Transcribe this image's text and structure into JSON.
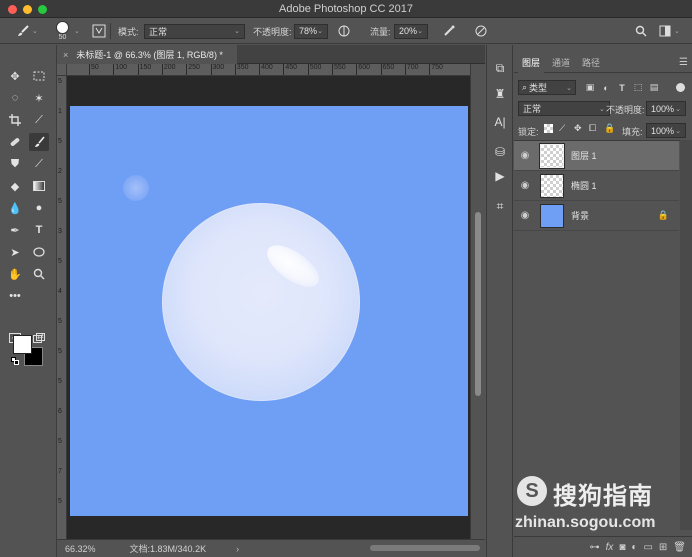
{
  "window": {
    "title": "Adobe Photoshop CC 2017"
  },
  "options_bar": {
    "brush_size": "50",
    "mode_label": "模式:",
    "mode_value": "正常",
    "opacity_label": "不透明度:",
    "opacity_value": "78%",
    "flow_label": "流量:",
    "flow_value": "20%"
  },
  "document": {
    "tab_title": "未标题-1 @ 66.3% (图层 1, RGB/8) *",
    "close_glyph": "×",
    "ruler_h": [
      "50",
      "100",
      "150",
      "200",
      "250",
      "300",
      "350",
      "400",
      "450",
      "500",
      "550",
      "600",
      "650",
      "700",
      "750"
    ],
    "ruler_v": [
      "5",
      "1",
      "5",
      "2",
      "5",
      "3",
      "5",
      "4",
      "5",
      "5",
      "5",
      "6",
      "5",
      "7",
      "5"
    ]
  },
  "status": {
    "zoom": "66.32%",
    "doc_size": "文档:1.83M/340.2K",
    "arrow": "›"
  },
  "layers_panel": {
    "tabs": [
      "图层",
      "通道",
      "路径"
    ],
    "filter_kind": "类型",
    "blend_mode": "正常",
    "opacity_label": "不透明度:",
    "opacity_value": "100%",
    "lock_label": "锁定:",
    "fill_label": "填充:",
    "fill_value": "100%",
    "layers": [
      {
        "name": "图层 1",
        "selected": true,
        "thumb": "transparent"
      },
      {
        "name": "椭圆 1",
        "selected": false,
        "thumb": "transparent"
      },
      {
        "name": "背景",
        "selected": false,
        "thumb": "#6f9ef5",
        "locked": true
      }
    ]
  },
  "colors": {
    "canvas": "#6f9ef5",
    "foreground": "#ffffff",
    "background": "#000000"
  },
  "watermark": {
    "brand": "搜狗指南",
    "logo_letter": "S",
    "url": "zhinan.sogou.com"
  }
}
